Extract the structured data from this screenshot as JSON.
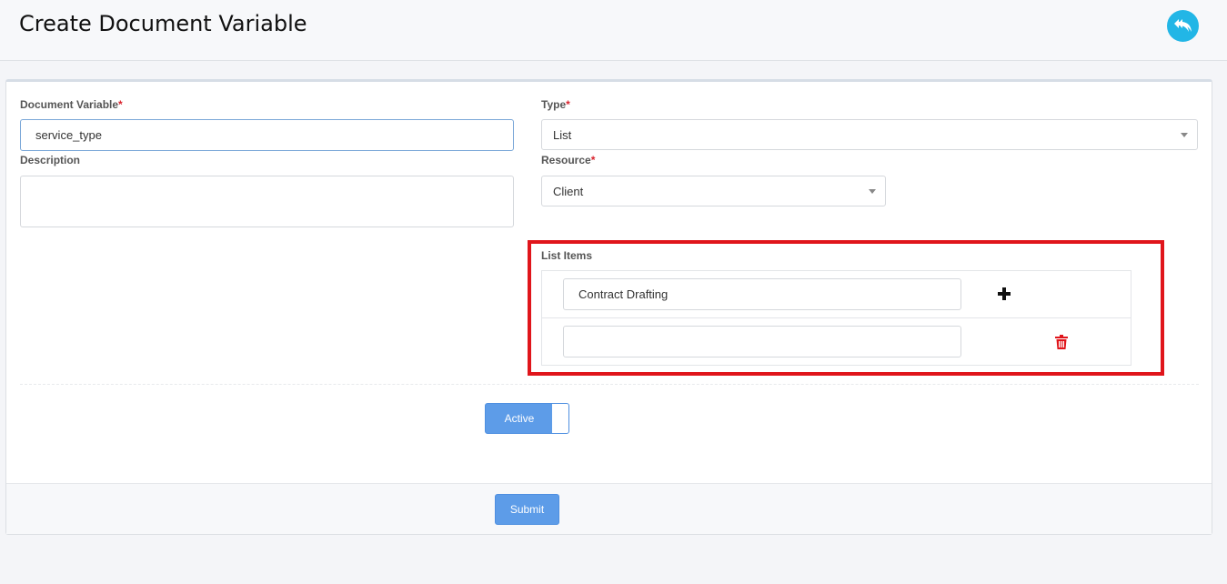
{
  "header": {
    "title": "Create Document Variable",
    "back_icon": "reply-icon",
    "back_color": "#22b6e6"
  },
  "form": {
    "document_variable": {
      "label": "Document Variable",
      "required_mark": "*",
      "value": "service_type"
    },
    "description": {
      "label": "Description",
      "value": ""
    },
    "type": {
      "label": "Type",
      "required_mark": "*",
      "selected": "List"
    },
    "resource": {
      "label": "Resource",
      "required_mark": "*",
      "selected": "Client"
    },
    "list_items": {
      "label": "List Items",
      "items": [
        {
          "value": "Contract Drafting",
          "action_icon": "plus-icon"
        },
        {
          "value": "",
          "action_icon": "trash-icon"
        }
      ]
    },
    "status_toggle": {
      "label": "Active",
      "on": true
    },
    "submit_label": "Submit"
  },
  "colors": {
    "accent": "#5d9ce8",
    "required": "#d9232d",
    "highlight": "#e0151b",
    "delete": "#e0151b"
  }
}
